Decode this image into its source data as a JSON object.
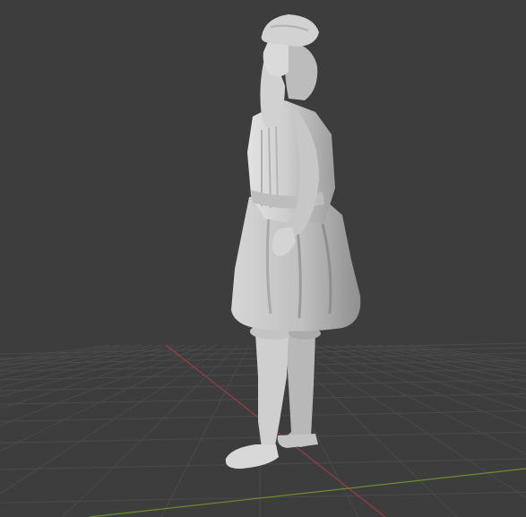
{
  "viewport": {
    "background": "#3d3d3d",
    "grid_color": "#4a4a4a",
    "x_axis_color": "#9a3c46",
    "y_axis_color": "#6c8e2a"
  },
  "scene": {
    "object": "statue-figure",
    "material_color": "#c9c9c9",
    "shading": "solid",
    "floor_grid": true
  }
}
